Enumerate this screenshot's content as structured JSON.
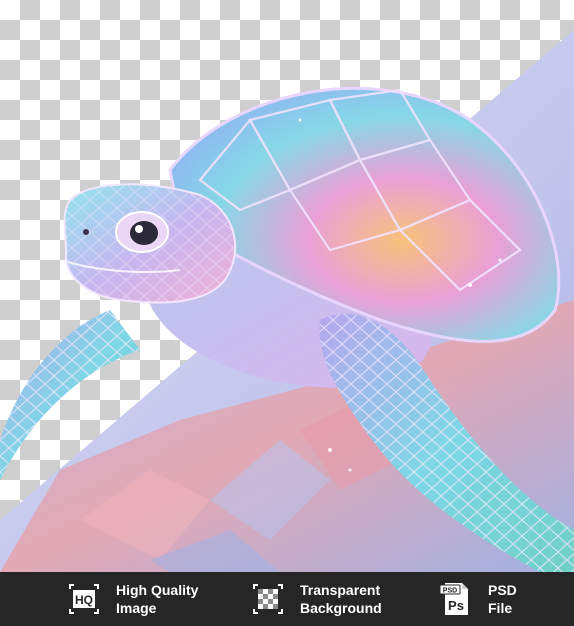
{
  "colors": {
    "bar_background": "#262626",
    "bar_text": "#ffffff",
    "checker_light": "#ffffff",
    "checker_dark": "#cfcfcf",
    "shell_teal": "#7fd7e6",
    "shell_orange": "#f6b26b",
    "background_lavender": "#c9c7ee",
    "ground_pink": "#e6a0a6"
  },
  "bottom_bar": {
    "items": [
      {
        "icon": "hq-icon",
        "icon_text": "HQ",
        "line1": "High Quality",
        "line2": "Image"
      },
      {
        "icon": "transparent-checker-icon",
        "line1": "Transparent",
        "line2": "Background"
      },
      {
        "icon": "psd-file-icon",
        "icon_text_top": "PSD",
        "icon_text": "Ps",
        "line1": "PSD",
        "line2": "File"
      }
    ]
  }
}
